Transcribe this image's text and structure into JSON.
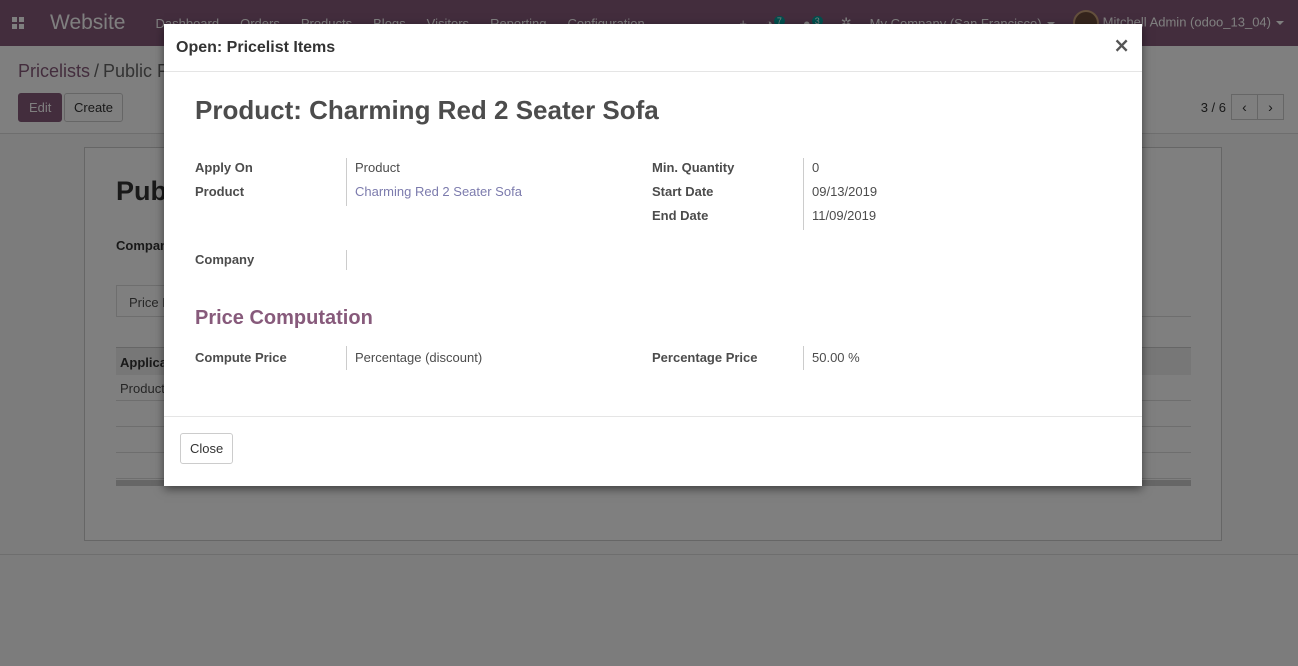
{
  "navbar": {
    "brand": "Website",
    "menu": [
      "Dashboard",
      "Orders",
      "Products",
      "Blogs",
      "Visitors",
      "Reporting",
      "Configuration"
    ],
    "activity_count": "7",
    "message_count": "3",
    "company": "My Company (San Francisco)",
    "user": "Mitchell Admin (odoo_13_04)"
  },
  "breadcrumb": {
    "parent": "Pricelists",
    "separator": "/",
    "current": "Public P"
  },
  "toolbar": {
    "edit_label": "Edit",
    "create_label": "Create"
  },
  "pager": {
    "value": "3 / 6",
    "prev_icon": "chevron-left-icon",
    "next_icon": "chevron-right-icon"
  },
  "sheet": {
    "title": "Pub",
    "company_label": "Compan",
    "tab_label": "Price R",
    "column_header": "Applica",
    "first_row": "Product"
  },
  "modal": {
    "title": "Open: Pricelist Items",
    "close_symbol": "×",
    "record_title": "Product: Charming Red 2 Seater Sofa",
    "fields": {
      "apply_on": {
        "label": "Apply On",
        "value": "Product"
      },
      "product": {
        "label": "Product",
        "value": "Charming Red 2 Seater Sofa"
      },
      "company": {
        "label": "Company",
        "value": ""
      },
      "min_quantity": {
        "label": "Min. Quantity",
        "value": "0"
      },
      "start_date": {
        "label": "Start Date",
        "value": "09/13/2019"
      },
      "end_date": {
        "label": "End Date",
        "value": "11/09/2019"
      },
      "compute_price": {
        "label": "Compute Price",
        "value": "Percentage (discount)"
      },
      "percentage_price": {
        "label": "Percentage Price",
        "value": "50.00 %"
      }
    },
    "section_title": "Price Computation",
    "close_button": "Close"
  },
  "colors": {
    "brand": "#875a7b",
    "link": "#7c7bad",
    "badge": "#00a09d"
  }
}
